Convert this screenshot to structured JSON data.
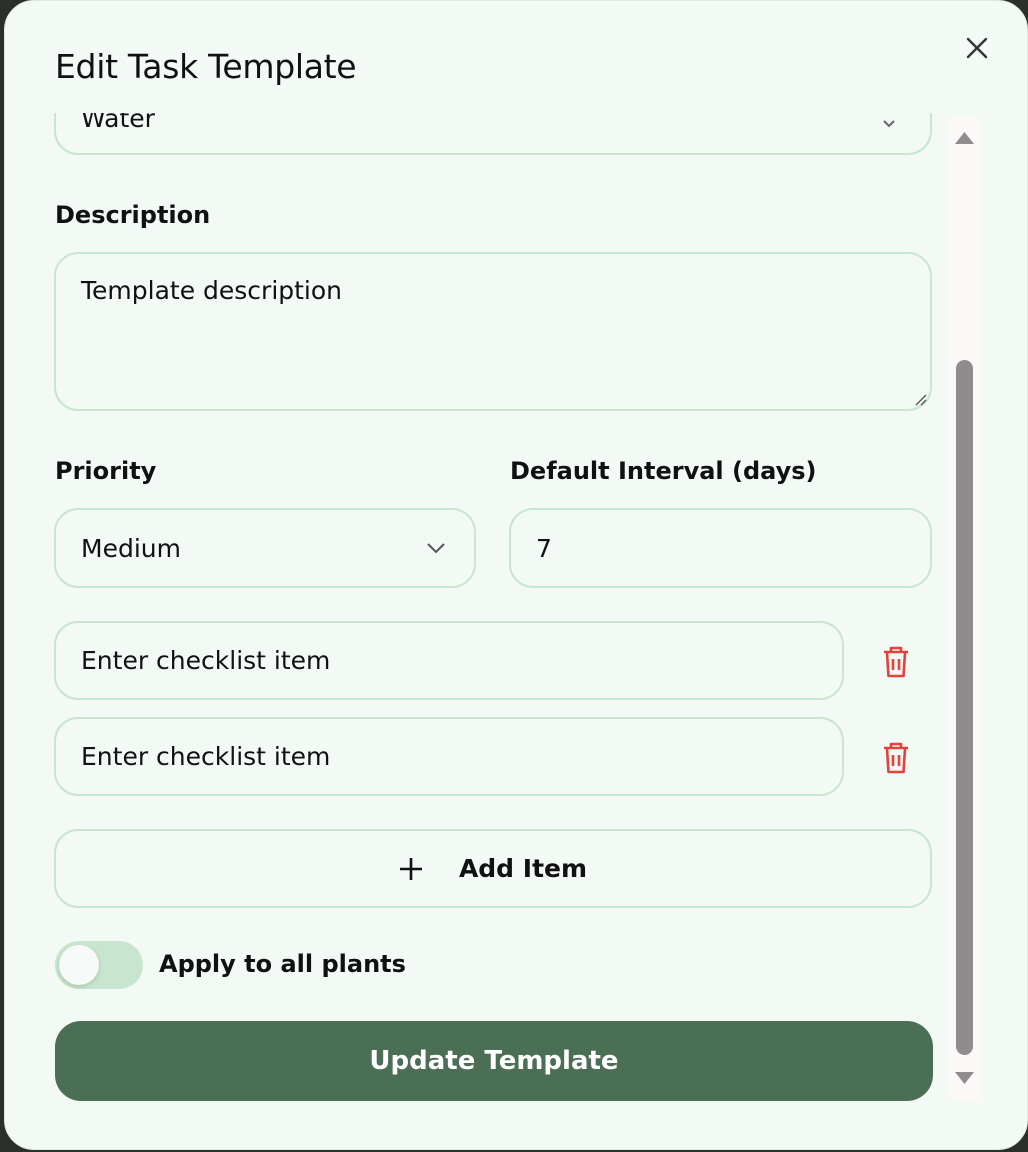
{
  "dialog": {
    "title": "Edit Task Template",
    "close_icon": "close-icon"
  },
  "form": {
    "task_type": {
      "value": "Water"
    },
    "description": {
      "label": "Description",
      "placeholder": "Template description",
      "value": ""
    },
    "priority": {
      "label": "Priority",
      "value": "Medium"
    },
    "interval": {
      "label": "Default Interval (days)",
      "value": "7"
    },
    "checklist": {
      "items": [
        {
          "placeholder": "Enter checklist item",
          "value": ""
        },
        {
          "placeholder": "Enter checklist item",
          "value": ""
        }
      ],
      "add_label": "Add Item"
    },
    "apply_all": {
      "label": "Apply to all plants",
      "enabled": false
    },
    "submit_label": "Update Template"
  },
  "colors": {
    "background": "#f3f9f4",
    "field_border": "#c8e6cf",
    "primary": "#4b6f54",
    "danger": "#e0433c",
    "toggle_track": "#c8e6cf"
  }
}
